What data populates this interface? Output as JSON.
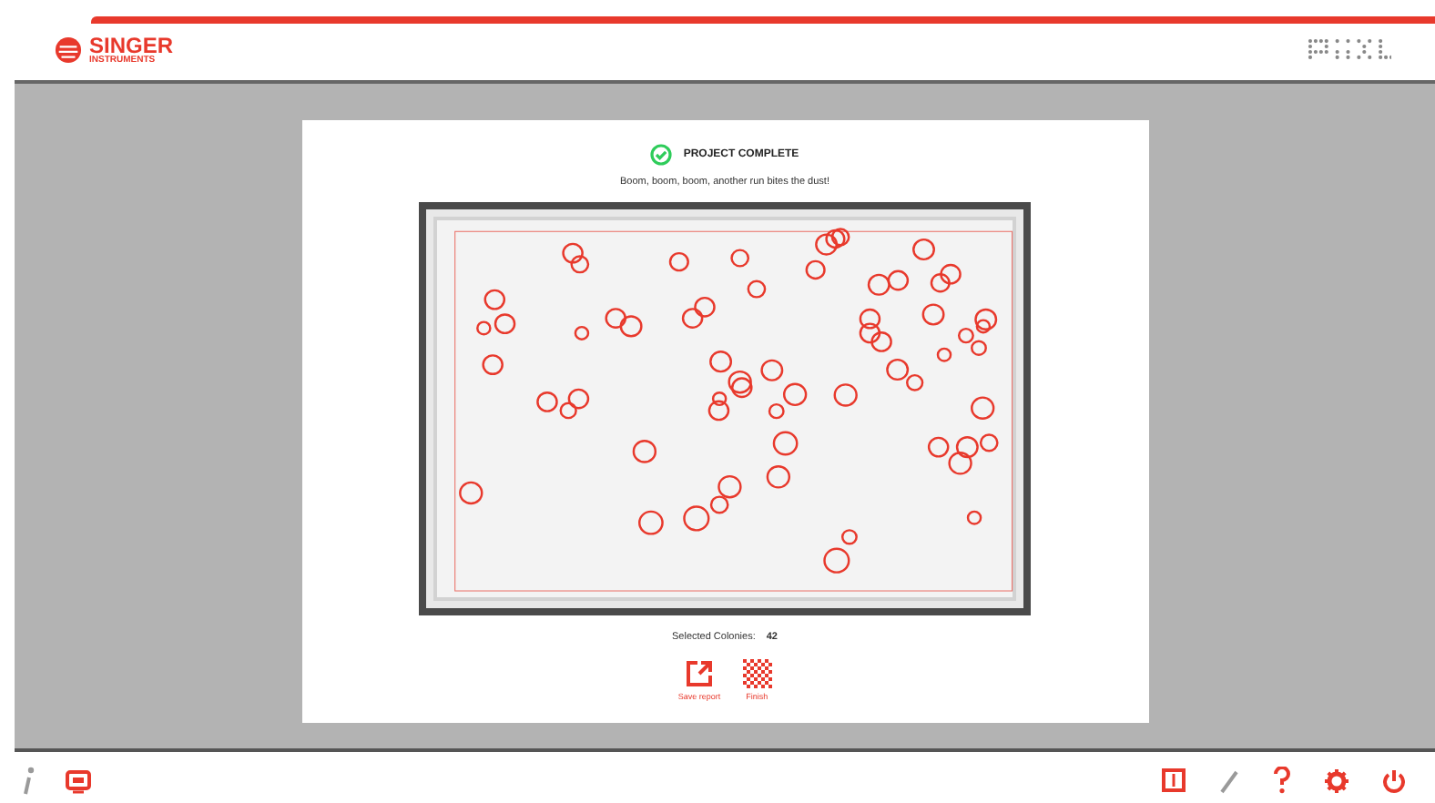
{
  "header": {
    "brand": "SINGER",
    "brand_sub": "INSTRUMENTS"
  },
  "result": {
    "status": "PROJECT COMPLETE",
    "message": "Boom, boom, boom, another run bites the dust!",
    "selected_label": "Selected Colonies:",
    "selected_count": "42"
  },
  "actions": [
    {
      "kind": "export",
      "label": "Save report"
    },
    {
      "kind": "checker",
      "label": "Finish"
    }
  ],
  "toolbar_left": [
    {
      "kind": "info",
      "disabled": true
    },
    {
      "kind": "screen",
      "disabled": false
    }
  ],
  "toolbar_right": [
    {
      "kind": "panel",
      "disabled": false
    },
    {
      "kind": "pencil",
      "disabled": true
    },
    {
      "kind": "help",
      "disabled": false
    },
    {
      "kind": "settings",
      "disabled": false
    },
    {
      "kind": "power",
      "disabled": false
    }
  ]
}
